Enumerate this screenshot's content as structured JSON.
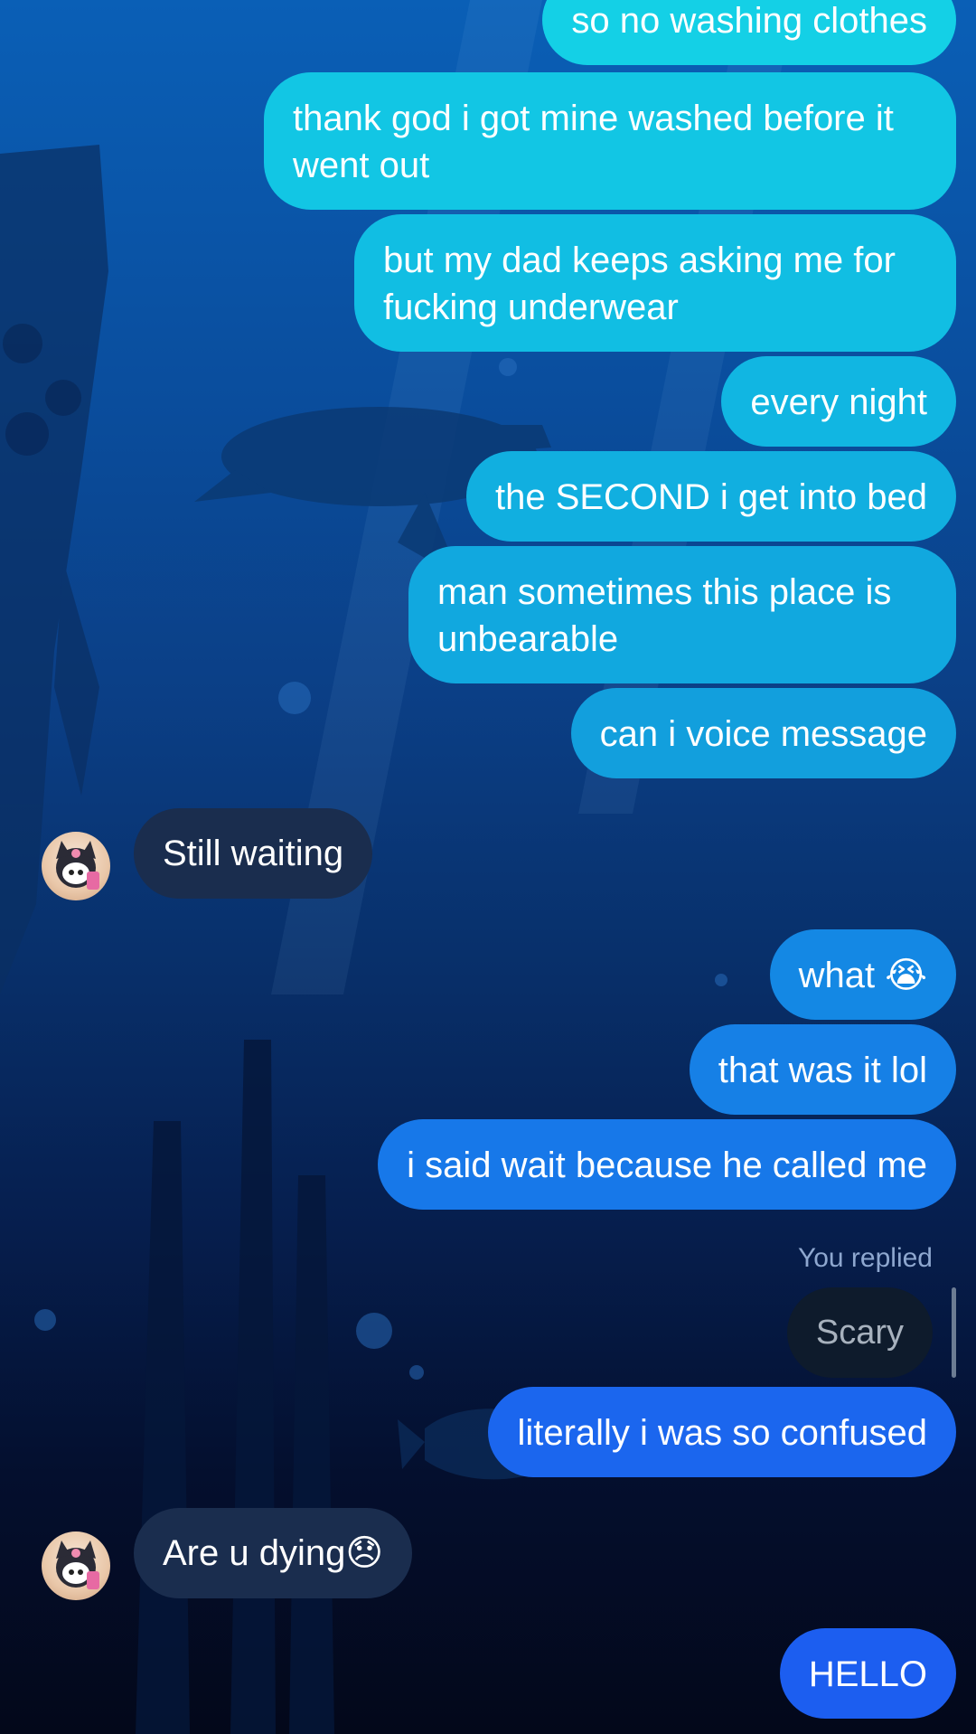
{
  "messages": [
    {
      "text": "so no washing clothes"
    },
    {
      "text": "thank god i got mine washed before it went out"
    },
    {
      "text": "but my dad keeps asking me for fucking underwear"
    },
    {
      "text": "every night"
    },
    {
      "text": "the SECOND i get into bed"
    },
    {
      "text": "man sometimes this place is unbearable"
    },
    {
      "text": "can i voice message"
    },
    {
      "text": "Still waiting"
    },
    {
      "text": "what 😭"
    },
    {
      "text": "that was it lol"
    },
    {
      "text": "i said wait because he called me"
    },
    {
      "text": "You replied"
    },
    {
      "text": "Scary"
    },
    {
      "text": "literally i was so confused"
    },
    {
      "text": "Are u dying😞"
    },
    {
      "text": "HELLO"
    }
  ],
  "colors": {
    "outgoing_top": "#14c8e6",
    "outgoing_mid": "#1296df",
    "outgoing_bottom": "#1c5ef0",
    "incoming": "#1a2d4e"
  },
  "icons": {
    "contact_avatar": "avatar-icon"
  }
}
